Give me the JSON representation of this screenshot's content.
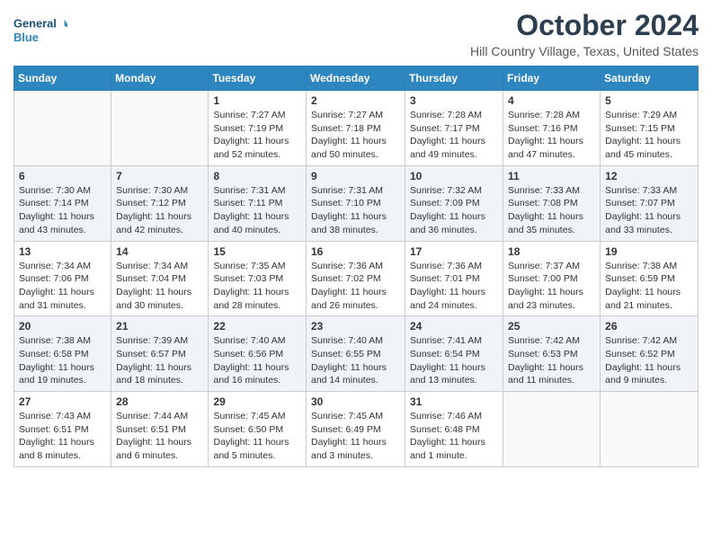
{
  "logo": {
    "line1": "General",
    "line2": "Blue"
  },
  "title": "October 2024",
  "location": "Hill Country Village, Texas, United States",
  "weekdays": [
    "Sunday",
    "Monday",
    "Tuesday",
    "Wednesday",
    "Thursday",
    "Friday",
    "Saturday"
  ],
  "weeks": [
    [
      {
        "day": "",
        "info": ""
      },
      {
        "day": "",
        "info": ""
      },
      {
        "day": "1",
        "info": "Sunrise: 7:27 AM\nSunset: 7:19 PM\nDaylight: 11 hours and 52 minutes."
      },
      {
        "day": "2",
        "info": "Sunrise: 7:27 AM\nSunset: 7:18 PM\nDaylight: 11 hours and 50 minutes."
      },
      {
        "day": "3",
        "info": "Sunrise: 7:28 AM\nSunset: 7:17 PM\nDaylight: 11 hours and 49 minutes."
      },
      {
        "day": "4",
        "info": "Sunrise: 7:28 AM\nSunset: 7:16 PM\nDaylight: 11 hours and 47 minutes."
      },
      {
        "day": "5",
        "info": "Sunrise: 7:29 AM\nSunset: 7:15 PM\nDaylight: 11 hours and 45 minutes."
      }
    ],
    [
      {
        "day": "6",
        "info": "Sunrise: 7:30 AM\nSunset: 7:14 PM\nDaylight: 11 hours and 43 minutes."
      },
      {
        "day": "7",
        "info": "Sunrise: 7:30 AM\nSunset: 7:12 PM\nDaylight: 11 hours and 42 minutes."
      },
      {
        "day": "8",
        "info": "Sunrise: 7:31 AM\nSunset: 7:11 PM\nDaylight: 11 hours and 40 minutes."
      },
      {
        "day": "9",
        "info": "Sunrise: 7:31 AM\nSunset: 7:10 PM\nDaylight: 11 hours and 38 minutes."
      },
      {
        "day": "10",
        "info": "Sunrise: 7:32 AM\nSunset: 7:09 PM\nDaylight: 11 hours and 36 minutes."
      },
      {
        "day": "11",
        "info": "Sunrise: 7:33 AM\nSunset: 7:08 PM\nDaylight: 11 hours and 35 minutes."
      },
      {
        "day": "12",
        "info": "Sunrise: 7:33 AM\nSunset: 7:07 PM\nDaylight: 11 hours and 33 minutes."
      }
    ],
    [
      {
        "day": "13",
        "info": "Sunrise: 7:34 AM\nSunset: 7:06 PM\nDaylight: 11 hours and 31 minutes."
      },
      {
        "day": "14",
        "info": "Sunrise: 7:34 AM\nSunset: 7:04 PM\nDaylight: 11 hours and 30 minutes."
      },
      {
        "day": "15",
        "info": "Sunrise: 7:35 AM\nSunset: 7:03 PM\nDaylight: 11 hours and 28 minutes."
      },
      {
        "day": "16",
        "info": "Sunrise: 7:36 AM\nSunset: 7:02 PM\nDaylight: 11 hours and 26 minutes."
      },
      {
        "day": "17",
        "info": "Sunrise: 7:36 AM\nSunset: 7:01 PM\nDaylight: 11 hours and 24 minutes."
      },
      {
        "day": "18",
        "info": "Sunrise: 7:37 AM\nSunset: 7:00 PM\nDaylight: 11 hours and 23 minutes."
      },
      {
        "day": "19",
        "info": "Sunrise: 7:38 AM\nSunset: 6:59 PM\nDaylight: 11 hours and 21 minutes."
      }
    ],
    [
      {
        "day": "20",
        "info": "Sunrise: 7:38 AM\nSunset: 6:58 PM\nDaylight: 11 hours and 19 minutes."
      },
      {
        "day": "21",
        "info": "Sunrise: 7:39 AM\nSunset: 6:57 PM\nDaylight: 11 hours and 18 minutes."
      },
      {
        "day": "22",
        "info": "Sunrise: 7:40 AM\nSunset: 6:56 PM\nDaylight: 11 hours and 16 minutes."
      },
      {
        "day": "23",
        "info": "Sunrise: 7:40 AM\nSunset: 6:55 PM\nDaylight: 11 hours and 14 minutes."
      },
      {
        "day": "24",
        "info": "Sunrise: 7:41 AM\nSunset: 6:54 PM\nDaylight: 11 hours and 13 minutes."
      },
      {
        "day": "25",
        "info": "Sunrise: 7:42 AM\nSunset: 6:53 PM\nDaylight: 11 hours and 11 minutes."
      },
      {
        "day": "26",
        "info": "Sunrise: 7:42 AM\nSunset: 6:52 PM\nDaylight: 11 hours and 9 minutes."
      }
    ],
    [
      {
        "day": "27",
        "info": "Sunrise: 7:43 AM\nSunset: 6:51 PM\nDaylight: 11 hours and 8 minutes."
      },
      {
        "day": "28",
        "info": "Sunrise: 7:44 AM\nSunset: 6:51 PM\nDaylight: 11 hours and 6 minutes."
      },
      {
        "day": "29",
        "info": "Sunrise: 7:45 AM\nSunset: 6:50 PM\nDaylight: 11 hours and 5 minutes."
      },
      {
        "day": "30",
        "info": "Sunrise: 7:45 AM\nSunset: 6:49 PM\nDaylight: 11 hours and 3 minutes."
      },
      {
        "day": "31",
        "info": "Sunrise: 7:46 AM\nSunset: 6:48 PM\nDaylight: 11 hours and 1 minute."
      },
      {
        "day": "",
        "info": ""
      },
      {
        "day": "",
        "info": ""
      }
    ]
  ]
}
